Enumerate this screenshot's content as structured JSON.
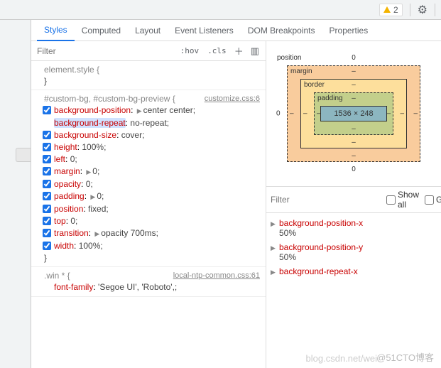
{
  "topbar": {
    "warnings": "2"
  },
  "tabs": [
    "Styles",
    "Computed",
    "Layout",
    "Event Listeners",
    "DOM Breakpoints",
    "Properties"
  ],
  "toolbar": {
    "filter_placeholder": "Filter",
    "hov": ":hov",
    "cls": ".cls"
  },
  "rules": [
    {
      "selector": "element.style {",
      "link": "",
      "decls": [],
      "close": "}"
    },
    {
      "selector": "#custom-bg, #custom-bg-preview {",
      "link": "customize.css:6",
      "decls": [
        {
          "prop": "background-position",
          "val": "center center",
          "exp": true,
          "checked": true,
          "hl": false
        },
        {
          "prop": "background-repeat",
          "val": "no-repeat",
          "exp": false,
          "checked": false,
          "hl": true,
          "nocb": true
        },
        {
          "prop": "background-size",
          "val": "cover",
          "exp": false,
          "checked": true
        },
        {
          "prop": "height",
          "val": "100%",
          "exp": false,
          "checked": true
        },
        {
          "prop": "left",
          "val": "0",
          "exp": false,
          "checked": true
        },
        {
          "prop": "margin",
          "val": "0",
          "exp": true,
          "checked": true
        },
        {
          "prop": "opacity",
          "val": "0",
          "exp": false,
          "checked": true
        },
        {
          "prop": "padding",
          "val": "0",
          "exp": true,
          "checked": true
        },
        {
          "prop": "position",
          "val": "fixed",
          "exp": false,
          "checked": true
        },
        {
          "prop": "top",
          "val": "0",
          "exp": false,
          "checked": true
        },
        {
          "prop": "transition",
          "val": "opacity 700ms",
          "exp": true,
          "checked": true
        },
        {
          "prop": "width",
          "val": "100%",
          "exp": false,
          "checked": true
        }
      ],
      "close": "}"
    },
    {
      "selector": ".win * {",
      "link": "local-ntp-common.css:61",
      "decls": [
        {
          "prop": "font-family",
          "val": "'Segoe UI', 'Roboto',",
          "exp": false,
          "checked": false,
          "nocb": true
        }
      ],
      "close": ""
    }
  ],
  "boxmodel": {
    "position": {
      "label": "position",
      "t": "0",
      "r": "",
      "b": "0",
      "l": "0"
    },
    "margin": {
      "label": "margin",
      "t": "‒",
      "r": "‒",
      "b": "‒",
      "l": "‒"
    },
    "border": {
      "label": "border",
      "t": "‒",
      "r": "‒",
      "b": "‒",
      "l": "‒"
    },
    "padding": {
      "label": "padding",
      "t": "‒",
      "r": "‒",
      "b": "‒",
      "l": "‒"
    },
    "content": "1536 × 248"
  },
  "computed": {
    "filter_placeholder": "Filter",
    "showall": "Show all",
    "group": "Gr",
    "items": [
      {
        "prop": "background-position-x",
        "val": "50%"
      },
      {
        "prop": "background-position-y",
        "val": "50%"
      },
      {
        "prop": "background-repeat-x",
        "val": ""
      }
    ]
  },
  "watermark": "blog.csdn.net/wei",
  "watermark2": "@51CTO博客"
}
